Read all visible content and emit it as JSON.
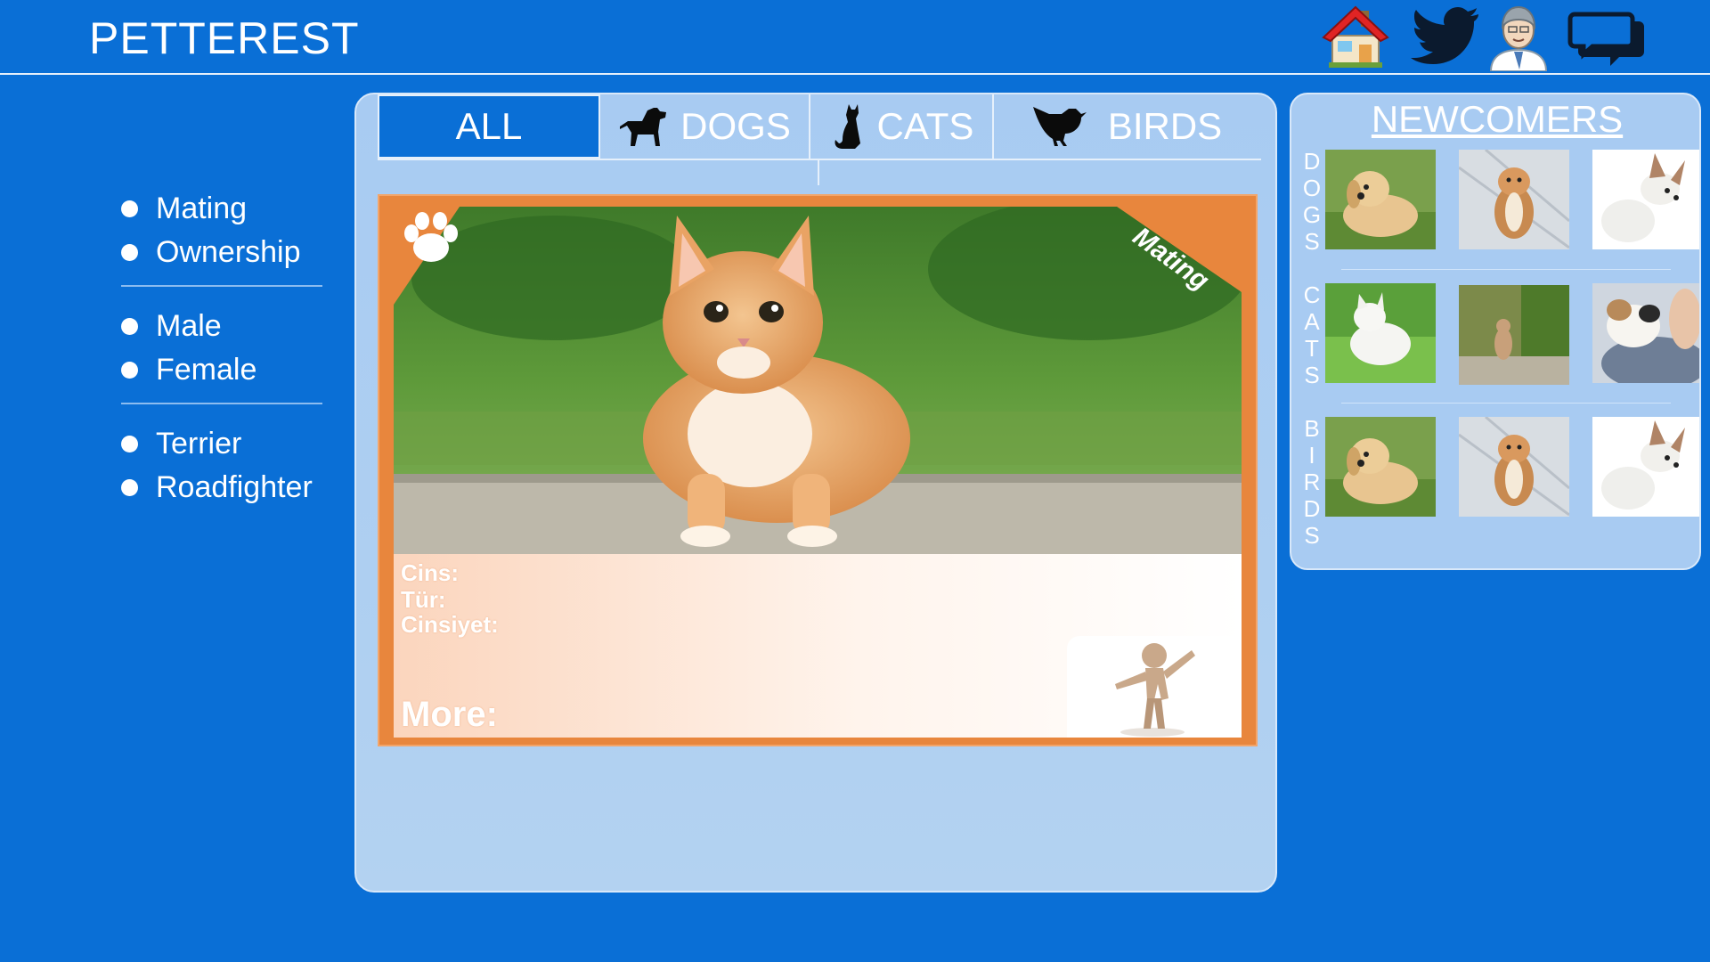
{
  "header": {
    "brand": "PETTEREST",
    "icons": [
      "home-icon",
      "twitter-bird-icon",
      "profile-icon",
      "chat-icon"
    ]
  },
  "filters": {
    "groups": [
      {
        "items": [
          "Mating",
          "Ownership"
        ]
      },
      {
        "items": [
          "Male",
          "Female"
        ]
      },
      {
        "items": [
          "Terrier",
          "Roadfighter"
        ]
      }
    ]
  },
  "tabs": [
    {
      "label": "ALL",
      "icon": null,
      "active": true
    },
    {
      "label": "DOGS",
      "icon": "dog-icon",
      "active": false
    },
    {
      "label": "CATS",
      "icon": "cat-icon",
      "active": false
    },
    {
      "label": "BIRDS",
      "icon": "bird-icon",
      "active": false
    }
  ],
  "card": {
    "ribbon": "Mating",
    "fields": [
      "Cins:",
      "Tür:",
      "Cinsiyet:"
    ],
    "more": "More:",
    "image": "orange-kitten-photo"
  },
  "newcomers": {
    "title": "NEWCOMERS",
    "rows": [
      {
        "label": "DOGS",
        "thumbs": [
          "golden-puppy-photo",
          "corgi-puppy-photo",
          "white-dog-photo"
        ]
      },
      {
        "label": "CATS",
        "thumbs": [
          "white-cat-photo",
          "tabby-cat-photo",
          "calico-cat-photo"
        ]
      },
      {
        "label": "BIRDS",
        "thumbs": [
          "golden-puppy-photo",
          "corgi-puppy-photo",
          "white-dog-photo"
        ]
      }
    ]
  },
  "colors": {
    "background": "#0a6fd6",
    "panel": "#a8cbf2",
    "card": "#e8863d"
  }
}
